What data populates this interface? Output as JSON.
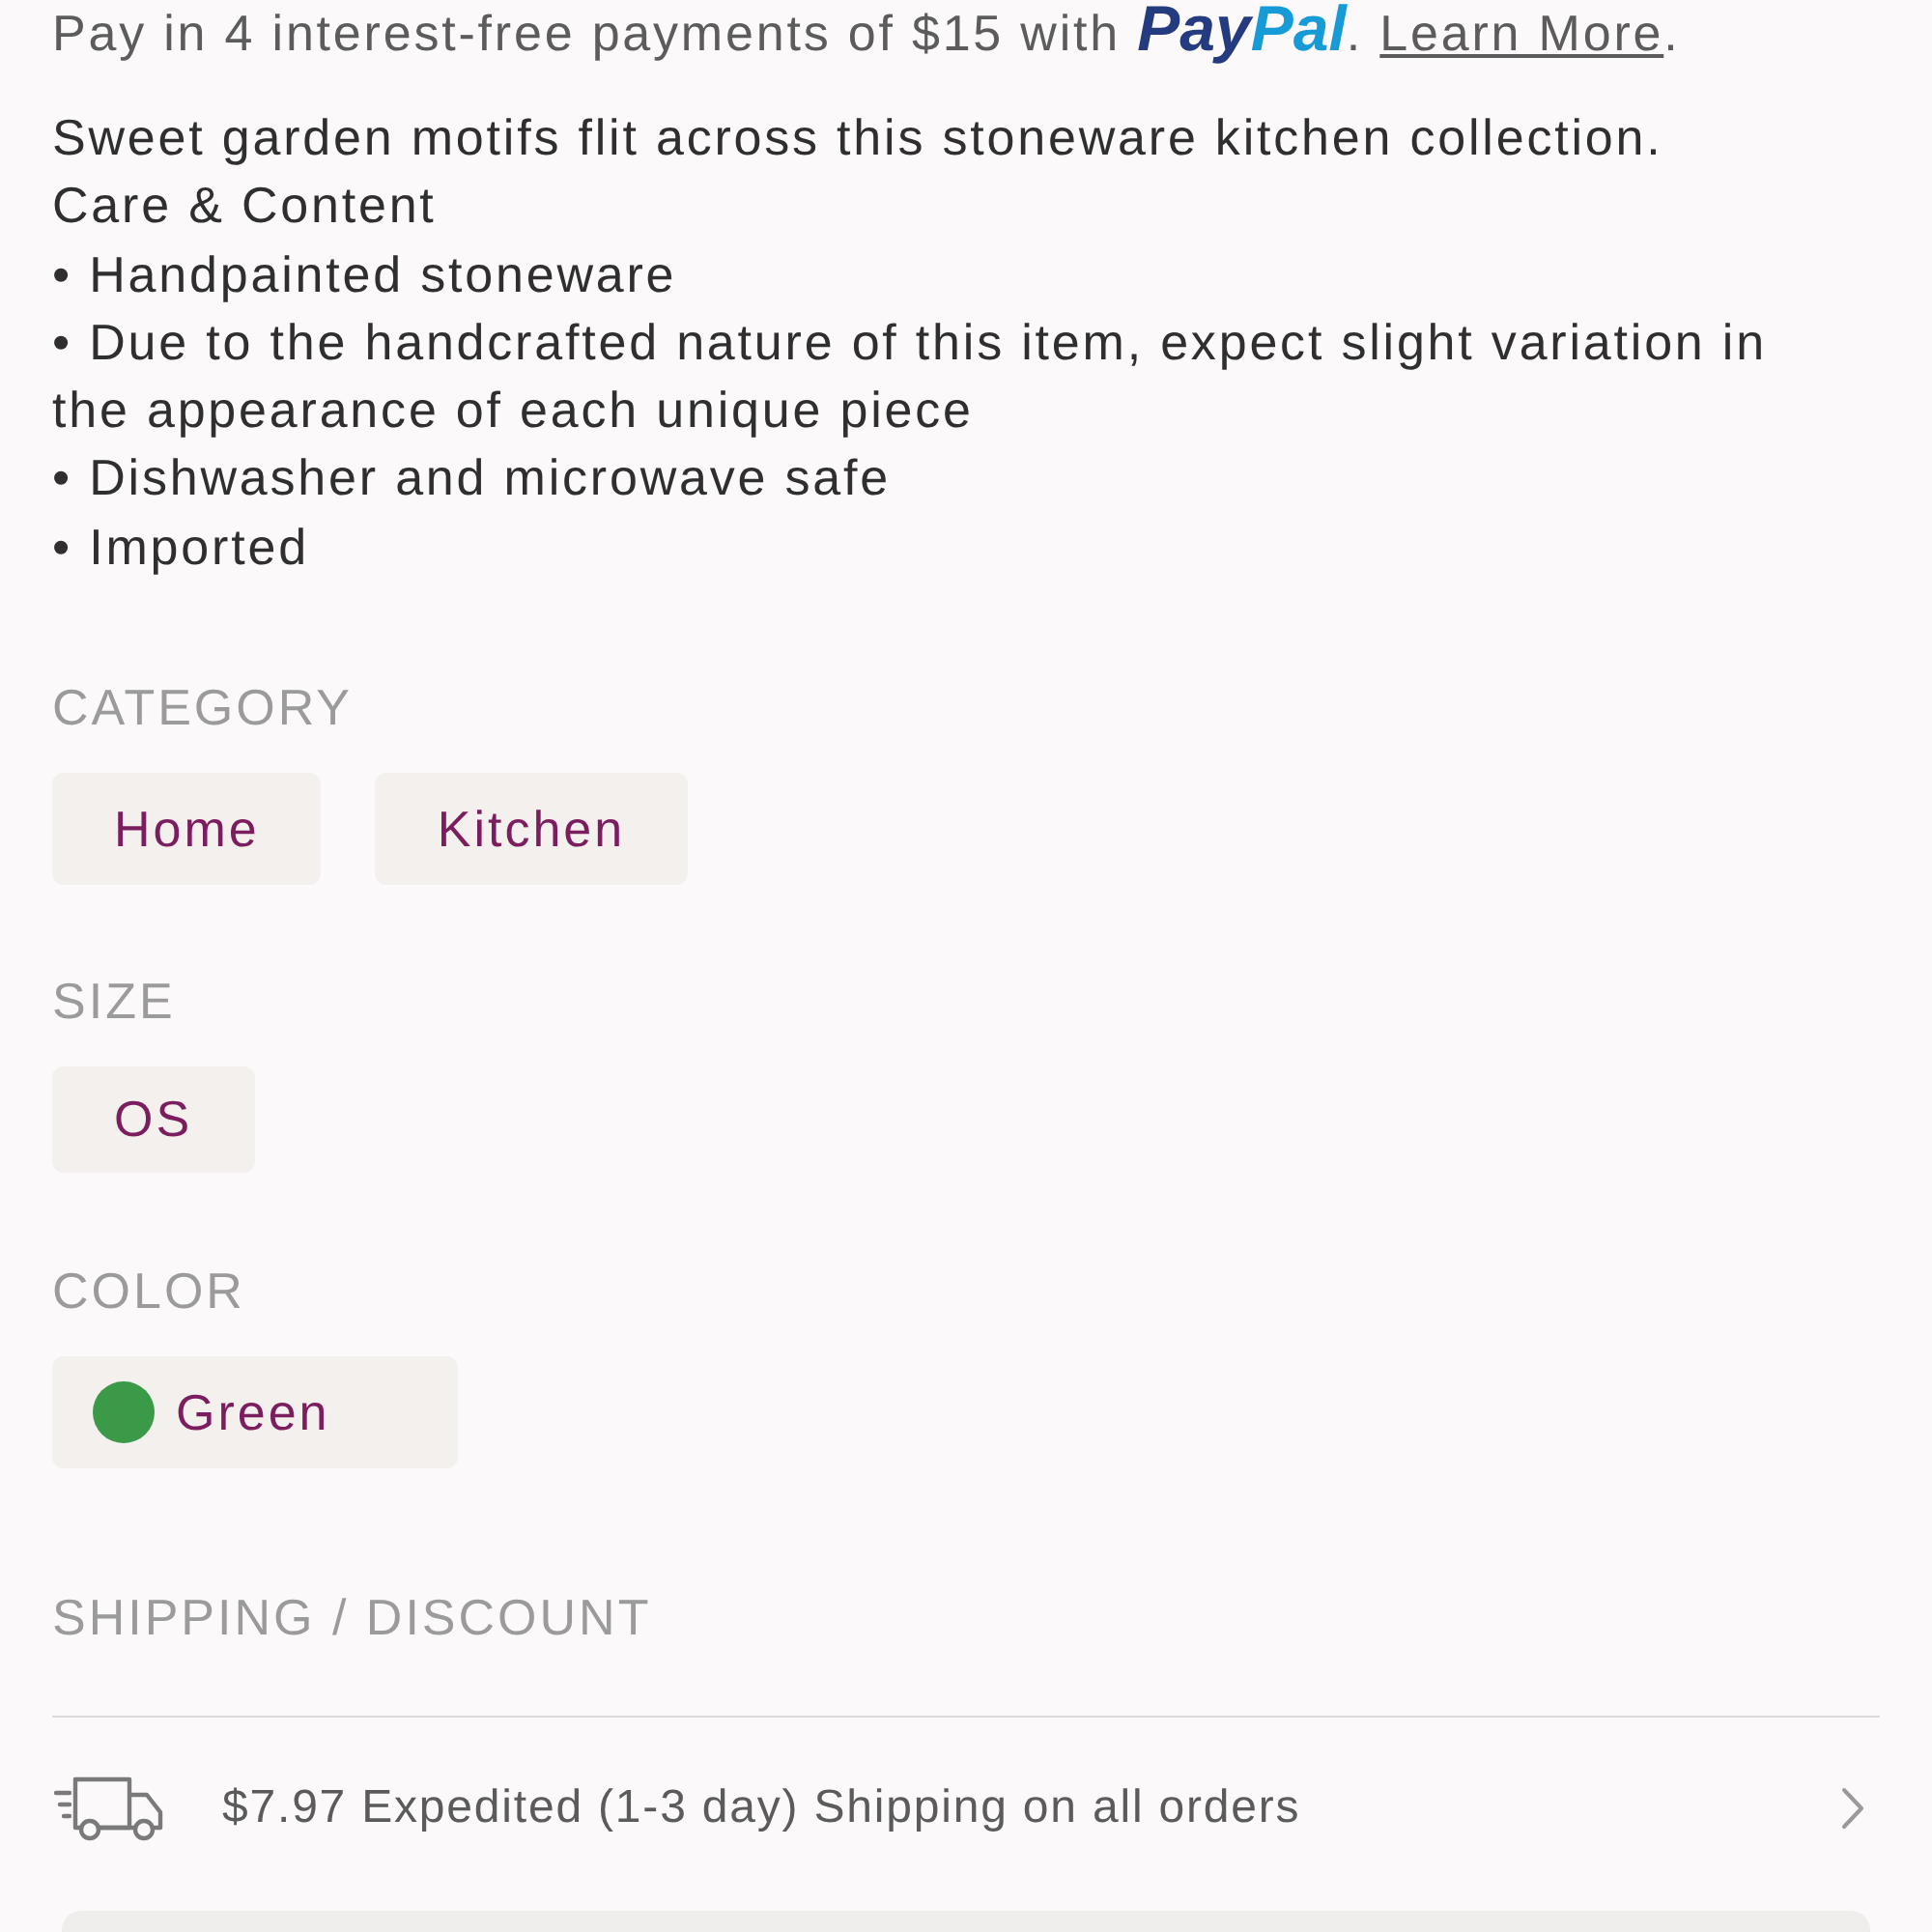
{
  "paypal_offer": {
    "text": "Pay in 4 interest-free payments of $15 with",
    "logo": [
      "Pay",
      "Pal"
    ],
    "after_logo": ".",
    "link": "Learn More",
    "end": "."
  },
  "description": {
    "intro": "Sweet garden motifs flit across this stoneware kitchen collection.",
    "care_heading": "Care & Content",
    "bullets": [
      "• Handpainted stoneware",
      "• Due to the handcrafted nature of this item, expect slight variation in the appearance of each unique piece",
      "• Dishwasher and microwave safe",
      "• Imported"
    ]
  },
  "category": {
    "heading": "CATEGORY",
    "tags": [
      "Home",
      "Kitchen"
    ]
  },
  "size": {
    "heading": "SIZE",
    "options": [
      "OS"
    ]
  },
  "color": {
    "heading": "COLOR",
    "options": [
      {
        "label": "Green",
        "color": "#3a9a48"
      }
    ]
  },
  "shipping": {
    "heading": "SHIPPING / DISCOUNT",
    "offers": [
      {
        "text": "$7.97 Expedited (1-3 day) Shipping on all orders"
      }
    ]
  }
}
